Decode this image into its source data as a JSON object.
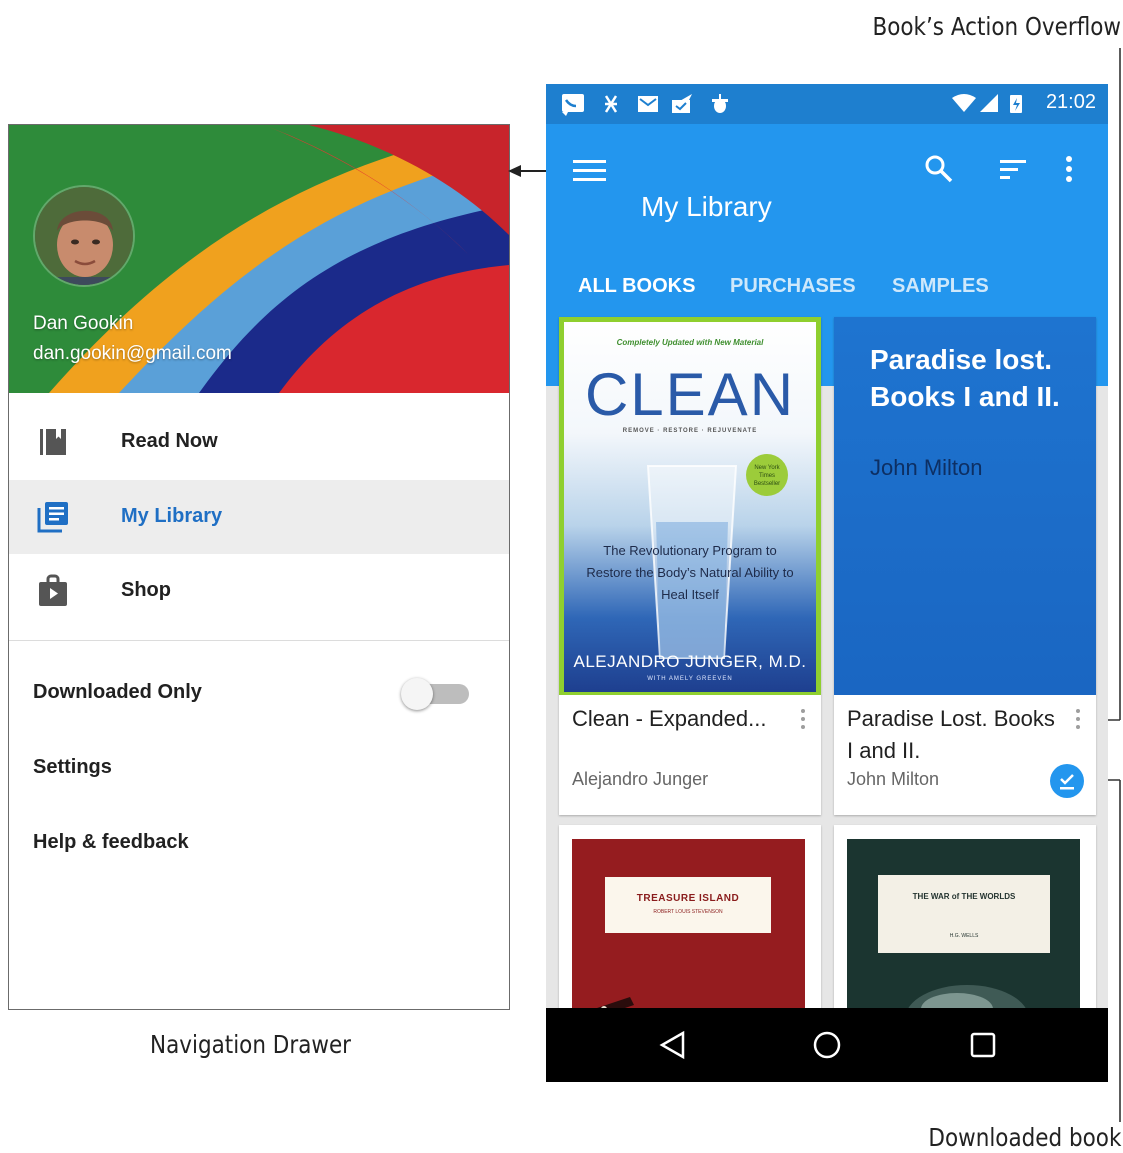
{
  "callouts": {
    "action_overflow": "Book’s Action Overflow",
    "navigation_drawer": "Navigation Drawer",
    "downloaded_book": "Downloaded book"
  },
  "drawer": {
    "user_name": "Dan Gookin",
    "user_email": "dan.gookin@gmail.com",
    "items": [
      {
        "label": "Read Now",
        "icon": "read-now-icon",
        "selected": false
      },
      {
        "label": "My Library",
        "icon": "library-icon",
        "selected": true
      },
      {
        "label": "Shop",
        "icon": "shop-icon",
        "selected": false
      }
    ],
    "downloaded_only": {
      "label": "Downloaded Only",
      "enabled": false
    },
    "settings_label": "Settings",
    "help_label": "Help & feedback"
  },
  "status_bar": {
    "time": "21:02"
  },
  "app_bar": {
    "title": "My Library",
    "tabs": [
      {
        "label": "ALL BOOKS",
        "active": true
      },
      {
        "label": "PURCHASES",
        "active": false
      },
      {
        "label": "SAMPLES",
        "active": false
      }
    ]
  },
  "books": [
    {
      "title": "Clean - Expanded...",
      "author": "Alejandro Junger",
      "downloaded": false,
      "cover": {
        "top_line": "Completely Updated with New Material",
        "word": "CLEAN",
        "subtitle": "REMOVE · RESTORE · REJUVENATE",
        "badge": "New York Times Bestseller",
        "blurb": "The Revolutionary Program to Restore the Body’s Natural Ability to Heal Itself",
        "author": "ALEJANDRO JUNGER, M.D.",
        "with": "WITH AMELY GREEVEN"
      }
    },
    {
      "title": "Paradise Lost. Books I and II.",
      "author": "John Milton",
      "downloaded": true,
      "cover": {
        "title": "Paradise lost. Books I and II.",
        "author": "John Milton"
      }
    },
    {
      "cover": {
        "title": "TREASURE ISLAND",
        "author": "ROBERT LOUIS STEVENSON"
      }
    },
    {
      "cover": {
        "title": "THE WAR of THE WORLDS",
        "author": "H.G. WELLS"
      }
    }
  ],
  "colors": {
    "app_bar": "#2396ee",
    "status_bar": "#1e7fcf",
    "accent": "#1f6fc4"
  }
}
